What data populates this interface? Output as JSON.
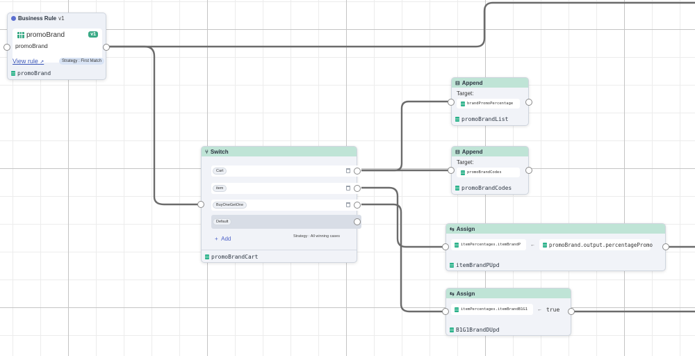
{
  "business_rule": {
    "title": "Business Rule",
    "version": "v1",
    "name": "promoBrand",
    "badge": "v1",
    "subtitle": "promoBrand",
    "view_link": "View rule",
    "strategy": "Strategy : First Match",
    "footer": "promoBrand"
  },
  "append_1": {
    "title": "Append",
    "target_label": "Target:",
    "target": "brandPromoPercentage",
    "footer": "promoBrandList"
  },
  "append_2": {
    "title": "Append",
    "target_label": "Target:",
    "target": "promoBrandCodes",
    "footer": "promoBrandCodes"
  },
  "switch": {
    "title": "Switch",
    "cases": [
      "Cart",
      "item",
      "BuyOneGetOne"
    ],
    "default": "Default",
    "add": "Add",
    "strategy": "Strategy : All winning cases",
    "footer": "promoBrandCart"
  },
  "assign_1": {
    "title": "Assign",
    "target": "itemPercentages.itemBrandP",
    "arrow": "←",
    "source": "promoBrand.output.percentagePromo",
    "footer": "itemBrandPUpd"
  },
  "assign_2": {
    "title": "Assign",
    "target": "itemPercentages.itemBrandB1G1",
    "arrow": "←",
    "value": "true",
    "footer": "B1G1BrandDUpd"
  },
  "colors": {
    "header_green": "#bfe4d6",
    "accent_green": "#3aaa86",
    "link_blue": "#3a56b8",
    "edge": "#6b6b6b"
  }
}
